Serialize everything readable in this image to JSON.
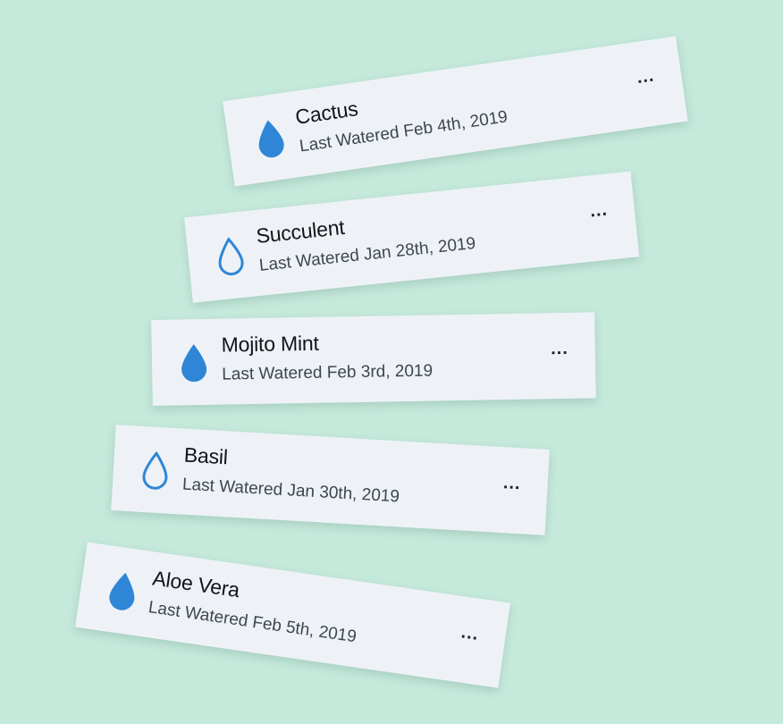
{
  "plants": [
    {
      "name": "Cactus",
      "last_watered": "Last Watered Feb 4th, 2019",
      "icon": "water-drop-filled-icon",
      "more": "..."
    },
    {
      "name": "Succulent",
      "last_watered": "Last Watered Jan 28th, 2019",
      "icon": "water-drop-outline-icon",
      "more": "..."
    },
    {
      "name": "Mojito Mint",
      "last_watered": "Last Watered Feb 3rd, 2019",
      "icon": "water-drop-filled-icon",
      "more": "..."
    },
    {
      "name": "Basil",
      "last_watered": "Last Watered Jan 30th, 2019",
      "icon": "water-drop-outline-icon",
      "more": "..."
    },
    {
      "name": "Aloe Vera",
      "last_watered": "Last Watered Feb 5th, 2019",
      "icon": "water-drop-filled-icon",
      "more": "..."
    }
  ],
  "colors": {
    "background": "#c5e9db",
    "card": "#eef2f7",
    "drop": "#2f86d6",
    "title": "#111418",
    "subtitle": "#3d4650"
  }
}
